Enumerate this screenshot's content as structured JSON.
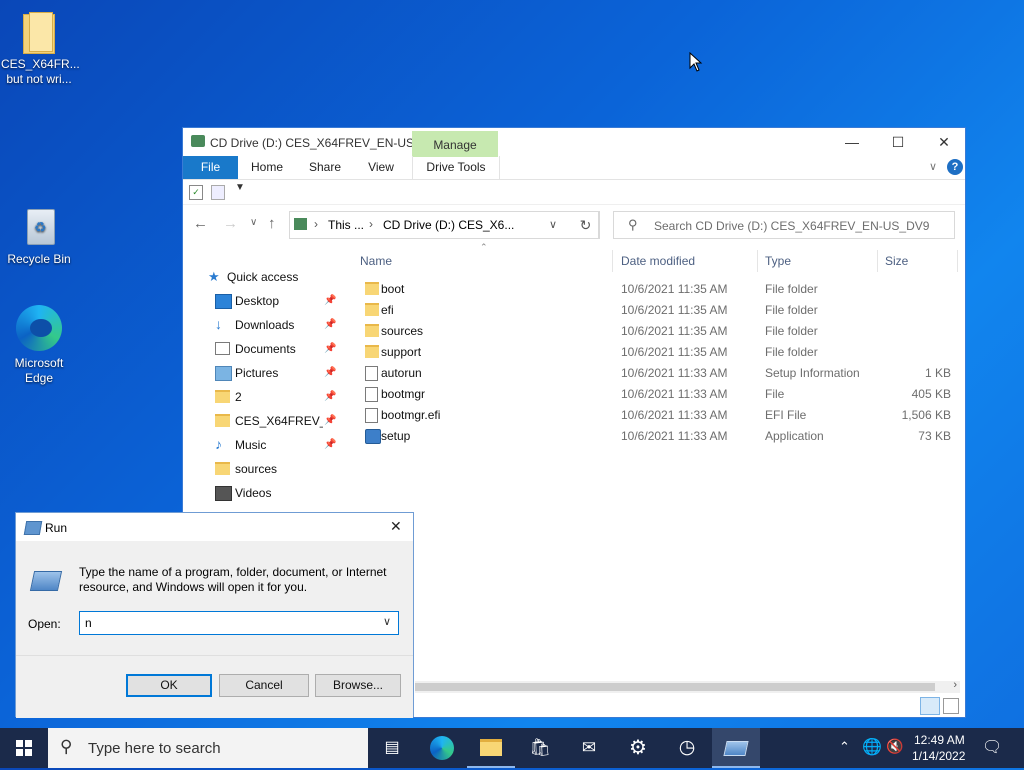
{
  "desktop": {
    "icons": [
      {
        "label": "CES_X64FR...\nbut not wri..."
      },
      {
        "label": "Recycle Bin"
      },
      {
        "label": "Microsoft Edge"
      }
    ]
  },
  "explorer": {
    "title": "CD Drive (D:) CES_X64FREV_EN-US_...",
    "manage_tab": "Manage",
    "drive_tools_tab": "Drive Tools",
    "tabs": [
      "File",
      "Home",
      "Share",
      "View"
    ],
    "address": {
      "part1": "This ...",
      "part2": "CD Drive (D:) CES_X6..."
    },
    "search_placeholder": "Search CD Drive (D:) CES_X64FREV_EN-US_DV9",
    "nav": {
      "quick_access": "Quick access",
      "items": [
        "Desktop",
        "Downloads",
        "Documents",
        "Pictures",
        "2",
        "CES_X64FREV_EN",
        "Music",
        "sources",
        "Videos"
      ]
    },
    "columns": {
      "name": "Name",
      "date": "Date modified",
      "type": "Type",
      "size": "Size"
    },
    "files": [
      {
        "name": "boot",
        "date": "10/6/2021 11:35 AM",
        "type": "File folder",
        "size": ""
      },
      {
        "name": "efi",
        "date": "10/6/2021 11:35 AM",
        "type": "File folder",
        "size": ""
      },
      {
        "name": "sources",
        "date": "10/6/2021 11:35 AM",
        "type": "File folder",
        "size": ""
      },
      {
        "name": "support",
        "date": "10/6/2021 11:35 AM",
        "type": "File folder",
        "size": ""
      },
      {
        "name": "autorun",
        "date": "10/6/2021 11:33 AM",
        "type": "Setup Information",
        "size": "1 KB"
      },
      {
        "name": "bootmgr",
        "date": "10/6/2021 11:33 AM",
        "type": "File",
        "size": "405 KB"
      },
      {
        "name": "bootmgr.efi",
        "date": "10/6/2021 11:33 AM",
        "type": "EFI File",
        "size": "1,506 KB"
      },
      {
        "name": "setup",
        "date": "10/6/2021 11:33 AM",
        "type": "Application",
        "size": "73 KB"
      }
    ]
  },
  "run": {
    "title": "Run",
    "description": "Type the name of a program, folder, document, or Internet resource, and Windows will open it for you.",
    "open_label": "Open:",
    "open_value": "n",
    "ok": "OK",
    "cancel": "Cancel",
    "browse": "Browse..."
  },
  "taskbar": {
    "search_placeholder": "Type here to search",
    "time": "12:49 AM",
    "date": "1/14/2022"
  }
}
